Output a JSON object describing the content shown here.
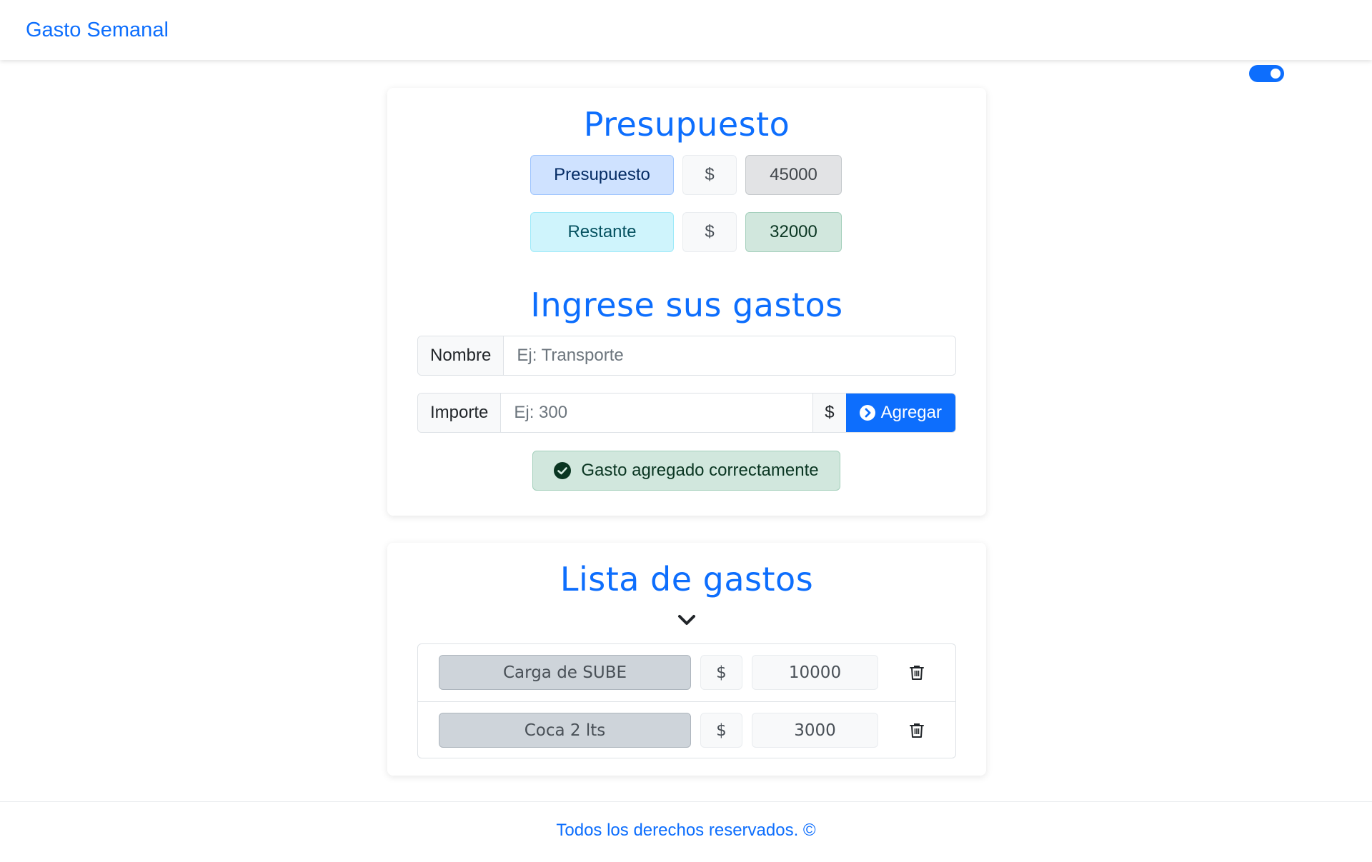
{
  "navbar": {
    "brand": "Gasto Semanal"
  },
  "theme_toggle": {
    "state": "on",
    "color": "#0d6efd"
  },
  "budget": {
    "title": "Presupuesto",
    "presupuesto_label": "Presupuesto",
    "presupuesto_currency": "$",
    "presupuesto_value": "45000",
    "restante_label": "Restante",
    "restante_currency": "$",
    "restante_value": "32000"
  },
  "form": {
    "title": "Ingrese sus gastos",
    "nombre_label": "Nombre",
    "nombre_placeholder": "Ej: Transporte",
    "importe_label": "Importe",
    "importe_placeholder": "Ej: 300",
    "currency": "$",
    "add_button": "Agregar",
    "add_icon": "chevron-right-circle-icon",
    "success_message": "Gasto agregado correctamente",
    "success_icon": "check-circle-icon"
  },
  "list": {
    "title": "Lista de gastos",
    "toggle_icon": "chevron-down-icon",
    "items": [
      {
        "name": "Carga de SUBE",
        "currency": "$",
        "amount": "10000",
        "delete_icon": "trash-icon"
      },
      {
        "name": "Coca 2 lts",
        "currency": "$",
        "amount": "3000",
        "delete_icon": "trash-icon"
      }
    ]
  },
  "footer": {
    "text": "Todos los derechos reservados. ©"
  },
  "colors": {
    "primary": "#0d6efd",
    "success_bg": "#d1e7dd",
    "info_bg": "#cff4fc"
  }
}
